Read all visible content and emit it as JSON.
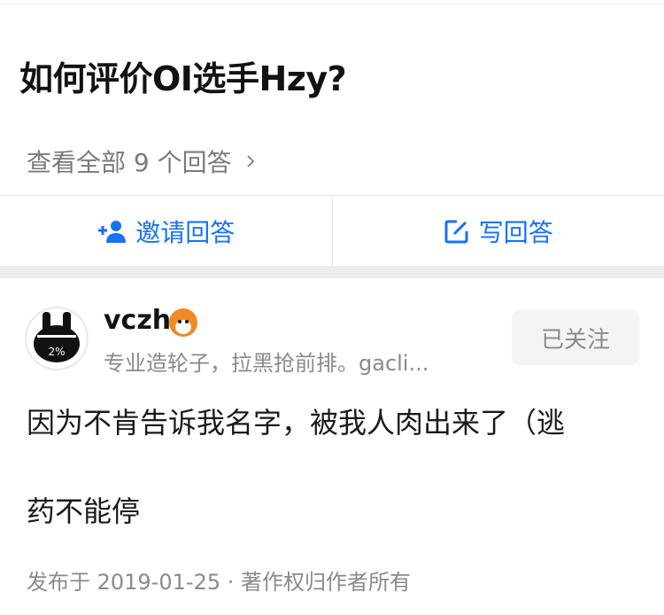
{
  "question": {
    "title": "如何评价OI选手Hzy?",
    "view_all_label": "查看全部 9 个回答"
  },
  "actions": {
    "invite_label": "邀请回答",
    "write_label": "写回答"
  },
  "answer": {
    "author": {
      "name": "vczh",
      "bio": "专业造轮子，拉黑抢前排。gacli...",
      "avatar_text": "2%",
      "follow_label": "已关注"
    },
    "lines": [
      "因为不肯告诉我名字，被我人肉出来了（逃",
      "药不能停"
    ],
    "meta": "发布于 2019-01-25 · 著作权归作者所有"
  },
  "colors": {
    "accent": "#1772f6",
    "muted": "#8a8a8a",
    "divider": "#e6e6e6"
  }
}
